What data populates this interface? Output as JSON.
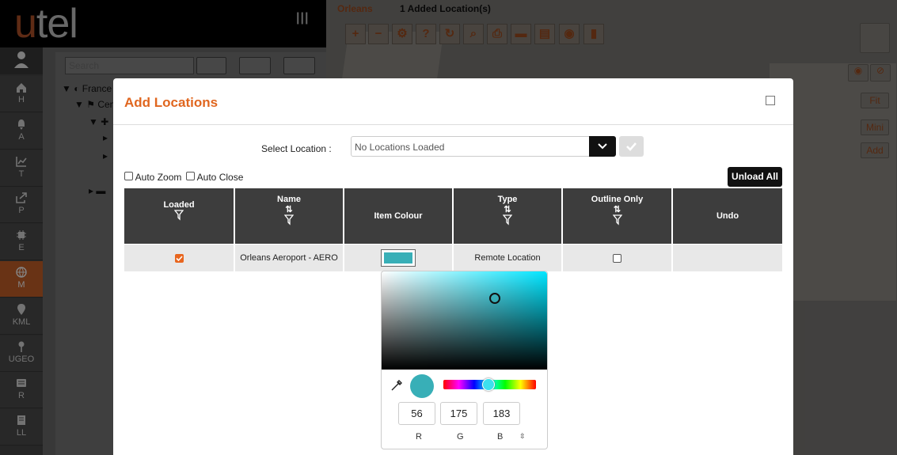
{
  "app": {
    "logo_u": "u",
    "logo_rest": "tel"
  },
  "nav": {
    "items": [
      {
        "label": "H",
        "icon": "home-icon"
      },
      {
        "label": "A",
        "icon": "bell-icon"
      },
      {
        "label": "T",
        "icon": "chart-icon"
      },
      {
        "label": "P",
        "icon": "share-icon"
      },
      {
        "label": "E",
        "icon": "chip-icon"
      },
      {
        "label": "M",
        "icon": "globe-icon"
      },
      {
        "label": "KML",
        "icon": "pin-icon"
      },
      {
        "label": "UGEO",
        "icon": "map-pin-icon"
      },
      {
        "label": "R",
        "icon": "list-icon"
      },
      {
        "label": "LL",
        "icon": "book-icon"
      }
    ]
  },
  "tree": {
    "search_placeholder": "Search",
    "root": "France",
    "child": "Cen"
  },
  "map": {
    "location": "Orleans",
    "status": "1 Added Location(s)",
    "side_buttons": {
      "fit": "Fit",
      "mini": "Mini",
      "add": "Add"
    }
  },
  "modal": {
    "title": "Add Locations",
    "select_label": "Select Location :",
    "select_value": "No Locations Loaded",
    "auto_zoom": "Auto Zoom",
    "auto_close": "Auto Close",
    "unload_all": "Unload All",
    "columns": [
      "Loaded",
      "Name",
      "Item Colour",
      "Type",
      "Outline Only",
      "Undo"
    ],
    "rows": [
      {
        "loaded": true,
        "name": "Orleans Aeroport - AERO",
        "colour": "#38afb7",
        "type": "Remote Location",
        "outline_only": false,
        "undo": ""
      }
    ]
  },
  "picker": {
    "r": "56",
    "g": "175",
    "b": "183",
    "r_label": "R",
    "g_label": "G",
    "b_label": "B",
    "color": "#38afb7"
  }
}
